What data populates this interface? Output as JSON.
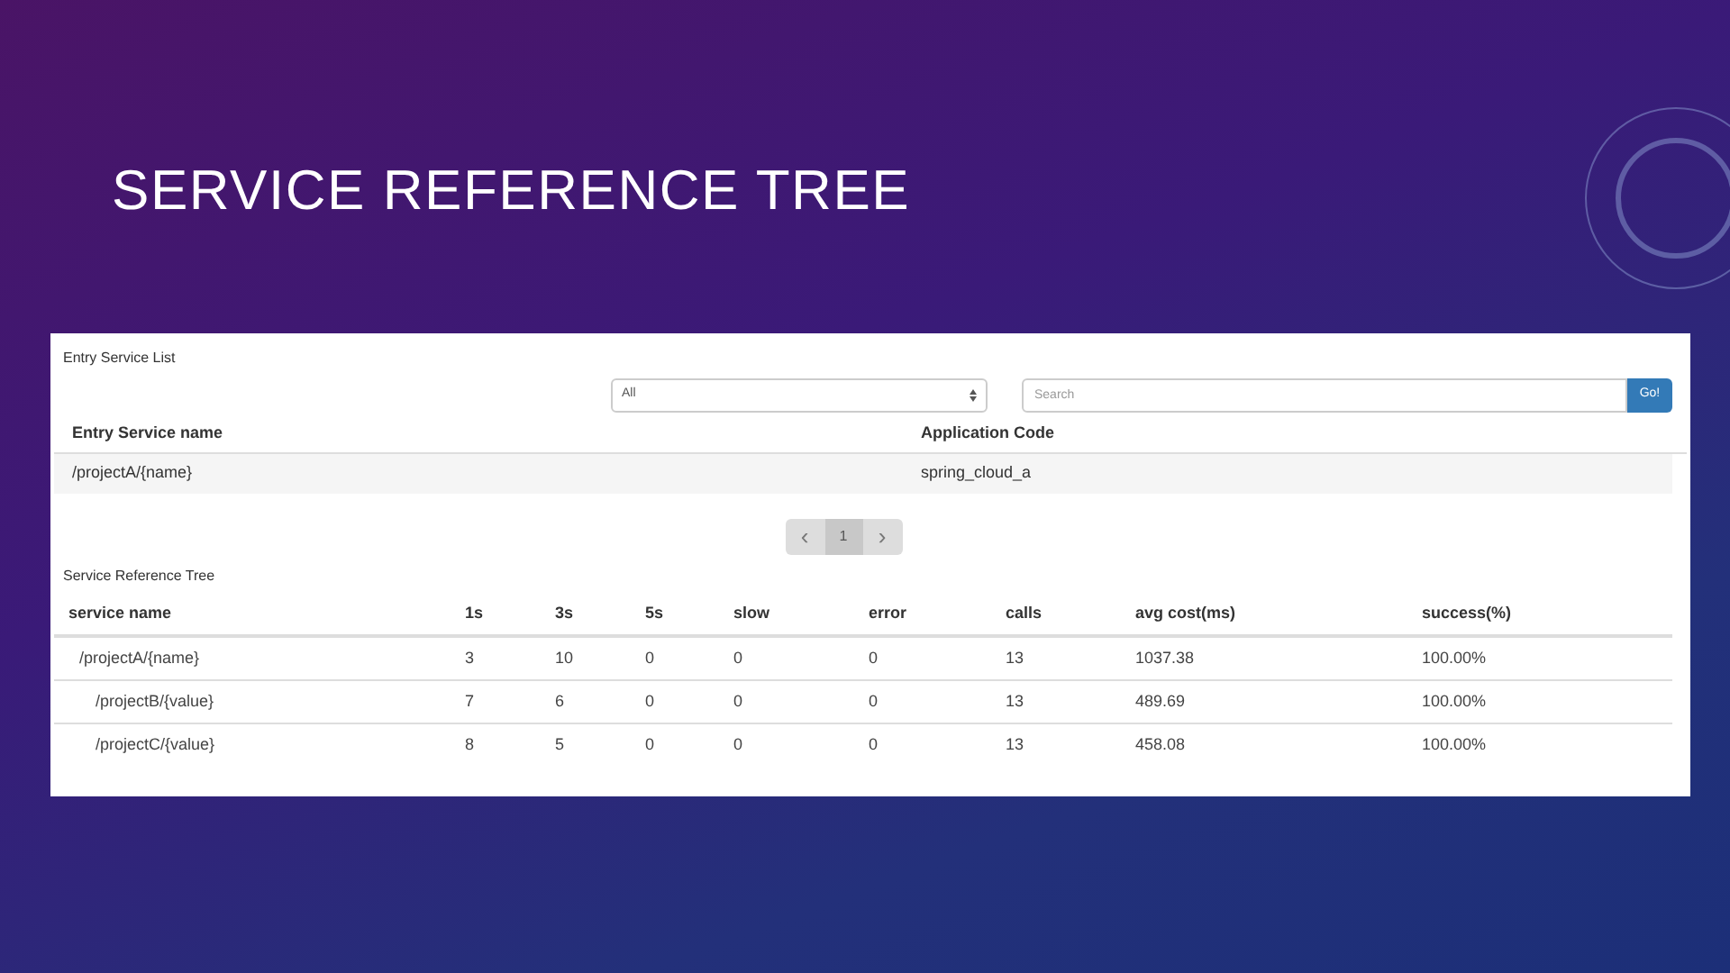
{
  "slide_title": "SERVICE REFERENCE TREE",
  "entry_list": {
    "title": "Entry Service List",
    "filter": {
      "value": "All"
    },
    "search": {
      "placeholder": "Search"
    },
    "search_button": "Go!",
    "columns": [
      "Entry Service name",
      "Application Code"
    ],
    "rows": [
      [
        "/projectA/{name}",
        "spring_cloud_a"
      ]
    ],
    "pagination": {
      "prev": "‹",
      "next": "›",
      "pages": [
        {
          "label": "1",
          "selected": true
        }
      ]
    }
  },
  "reference_tree": {
    "title": "Service Reference Tree",
    "columns": [
      "service name",
      "1s",
      "3s",
      "5s",
      "slow",
      "error",
      "calls",
      "avg cost(ms)",
      "success(%)"
    ],
    "rows": [
      {
        "cells": [
          "/projectA/{name}",
          "3",
          "10",
          "0",
          "0",
          "0",
          "13",
          "1037.38",
          "100.00%"
        ],
        "children": [
          {
            "cells": [
              "/projectB/{value}",
              "7",
              "6",
              "0",
              "0",
              "0",
              "13",
              "489.69",
              "100.00%"
            ]
          },
          {
            "cells": [
              "/projectC/{value}",
              "8",
              "5",
              "0",
              "0",
              "0",
              "13",
              "458.08",
              "100.00%"
            ]
          }
        ]
      }
    ]
  }
}
